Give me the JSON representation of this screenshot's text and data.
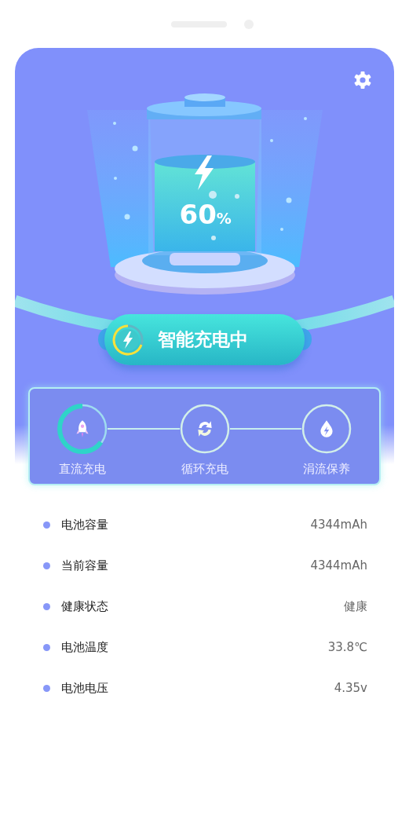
{
  "battery": {
    "percent": "60",
    "unit": "%"
  },
  "status": {
    "label": "智能充电中"
  },
  "modes": [
    {
      "label": "直流充电",
      "kind": "rocket",
      "selected": true
    },
    {
      "label": "循环充电",
      "kind": "cycle",
      "selected": false
    },
    {
      "label": "涓流保养",
      "kind": "drop",
      "selected": false
    }
  ],
  "info": [
    {
      "label": "电池容量",
      "value": "4344mAh"
    },
    {
      "label": "当前容量",
      "value": "4344mAh"
    },
    {
      "label": "健康状态",
      "value": "健康"
    },
    {
      "label": "电池温度",
      "value": "33.8℃"
    },
    {
      "label": "电池电压",
      "value": "4.35v"
    }
  ]
}
